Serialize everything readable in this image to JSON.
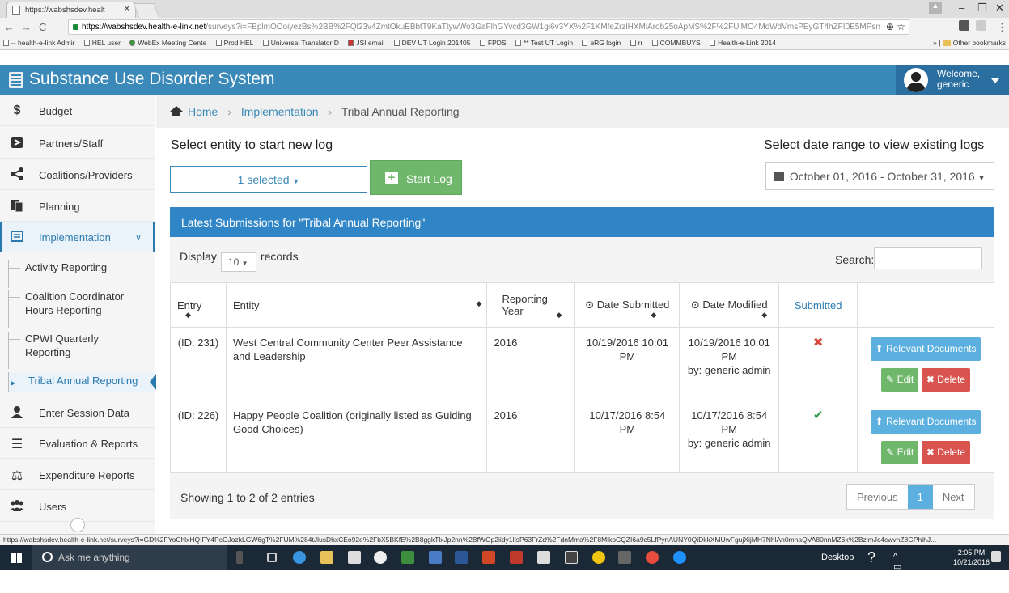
{
  "browser": {
    "tab_title": "https://wabshsdev.healt",
    "url_host": "https://wabshsdev.health-e-link.net",
    "url_path": "/surveys?i=FBplmOOoiyezBs%2BB%2FQl23v4ZmtOkuEBbtT9KaTtywWo3GaFlhGYvcd3GW1gi6v3YX%2F1KMfeZrzlHXMiArob25oApMS%2F%2FUiMO4MoWdVmsPEyGT4hZFI0E5MPsn",
    "bookmarks": [
      "-- health-e-link Admir",
      "HEL user",
      "WebEx Meeting Cente",
      "Prod HEL",
      "Universal Translator D",
      "JSI email",
      "DEV UT Login 201405",
      "FPDS",
      "** Test UT Login",
      "eRG login",
      "rr",
      "COMMBUYS",
      "Health-e-Link 2014"
    ],
    "other_bookmarks": "Other bookmarks",
    "status_url": "https://wabshsdev.health-e-link.net/surveys?i=GD%2FYoChlxHQIFY4PcOJozkLGW6gT%2FUM%284tJlusDhxCEo92e%2FbX5BKfE%2B8ggkTlxJp2nn%2BfWOp2iidy1IlsP63FrZd%2FdnMma%2F8MlkoCQZI6a9c5LfPynAUNY0QiDkkXMUwFgujXijMH7NhlAn0mnaQVA80nnMZ6k%2BzlmJc4cwvnZ8GPhihJ..."
  },
  "app": {
    "title": "Substance Use Disorder System",
    "welcome": "Welcome,",
    "user": "generic"
  },
  "sidebar": {
    "items": [
      {
        "label": "Budget",
        "icon": "dollar-icon"
      },
      {
        "label": "Partners/Staff",
        "icon": "partners-icon"
      },
      {
        "label": "Coalitions/Providers",
        "icon": "share-icon"
      },
      {
        "label": "Planning",
        "icon": "planning-icon"
      },
      {
        "label": "Implementation",
        "icon": "list-icon"
      },
      {
        "label": "Enter Session Data",
        "icon": "user-icon"
      },
      {
        "label": "Evaluation & Reports",
        "icon": "bars-icon"
      },
      {
        "label": "Expenditure Reports",
        "icon": "scale-icon"
      },
      {
        "label": "Users",
        "icon": "users-icon"
      }
    ],
    "subitems": [
      "Activity Reporting",
      "Coalition Coordinator Hours Reporting",
      "CPWI Quarterly Reporting",
      "Tribal Annual Reporting"
    ]
  },
  "breadcrumb": {
    "home": "Home",
    "section": "Implementation",
    "page": "Tribal Annual Reporting"
  },
  "main": {
    "new_log_heading": "Select entity to start new log",
    "existing_heading": "Select date range to view existing logs",
    "entity_select": "1 selected",
    "start_log": "Start Log",
    "date_range": "October 01, 2016 - October 31, 2016",
    "panel_title": "Latest Submissions for \"Tribal Annual Reporting\"",
    "display_label": "Display",
    "display_value": "10",
    "records_label": "records",
    "search_label": "Search:",
    "showing": "Showing 1 to 2 of 2 entries",
    "pager": {
      "prev": "Previous",
      "page": "1",
      "next": "Next"
    }
  },
  "table": {
    "headers": [
      "Entry",
      "Entity",
      "Reporting Year",
      "Date Submitted",
      "Date Modified",
      "Submitted"
    ],
    "rows": [
      {
        "entry": "(ID: 231)",
        "entity": "West Central Community Center Peer Assistance and Leadership",
        "year": "2016",
        "submitted_date": "10/19/2016 10:01 PM",
        "modified_date": "10/19/2016 10:01 PM",
        "modified_by": "by: generic admin",
        "submitted": false
      },
      {
        "entry": "(ID: 226)",
        "entity": "Happy People Coalition (originally listed as Guiding Good Choices)",
        "year": "2016",
        "submitted_date": "10/17/2016 8:54 PM",
        "modified_date": "10/17/2016 8:54 PM",
        "modified_by": "by: generic admin",
        "submitted": true
      }
    ],
    "actions": {
      "docs": "Relevant Documents",
      "edit": "Edit",
      "delete": "Delete"
    }
  },
  "taskbar": {
    "search_placeholder": "Ask me anything",
    "desktop": "Desktop",
    "time": "2:05 PM",
    "date": "10/21/2016"
  },
  "colors": {
    "header": "#3b89b8",
    "panel_header": "#2f85c6",
    "success": "#6fb76b",
    "danger": "#d9534f",
    "info": "#5bb0e0"
  }
}
